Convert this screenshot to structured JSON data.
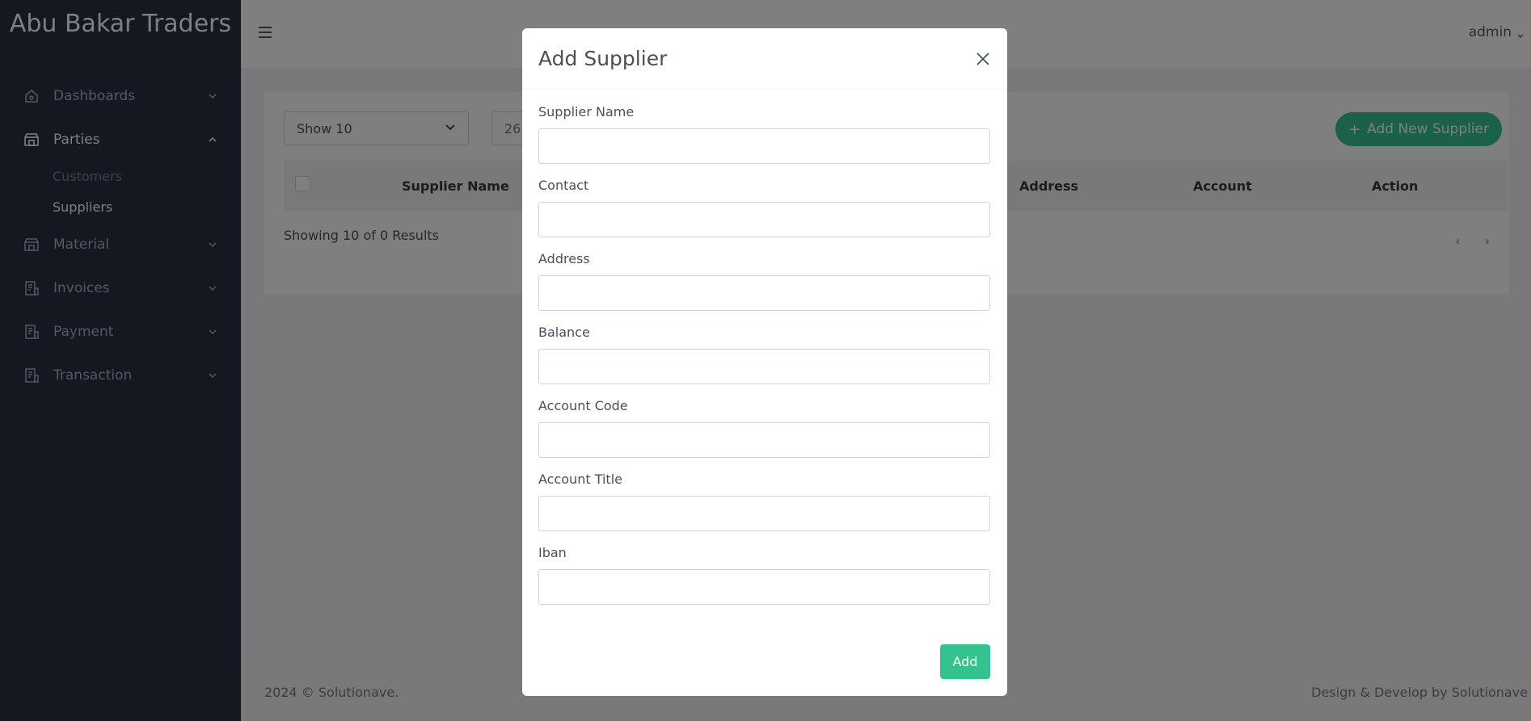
{
  "sidebar": {
    "brand": "Abu Bakar Traders",
    "items": [
      {
        "label": "Dashboards",
        "icon": "home-icon"
      },
      {
        "label": "Parties",
        "icon": "store-icon"
      },
      {
        "label": "Material",
        "icon": "store-icon"
      },
      {
        "label": "Invoices",
        "icon": "invoice-icon"
      },
      {
        "label": "Payment",
        "icon": "invoice-icon"
      },
      {
        "label": "Transaction",
        "icon": "invoice-icon"
      }
    ],
    "sub_items": [
      {
        "label": "Customers"
      },
      {
        "label": "Suppliers"
      }
    ]
  },
  "topbar": {
    "user": "admin"
  },
  "card": {
    "show_select": "Show 10",
    "search_value": "26",
    "add_new_label": "Add New Supplier",
    "columns": [
      "Supplier Name",
      "Address",
      "Account",
      "Action"
    ],
    "showing_text": "Showing 10 of 0 Results"
  },
  "footer": {
    "left": "2024 © Solutionave.",
    "right": "Design & Develop by Solutionave"
  },
  "modal": {
    "title": "Add Supplier",
    "fields": [
      {
        "label": "Supplier Name",
        "value": ""
      },
      {
        "label": "Contact",
        "value": ""
      },
      {
        "label": "Address",
        "value": ""
      },
      {
        "label": "Balance",
        "value": ""
      },
      {
        "label": "Account Code",
        "value": ""
      },
      {
        "label": "Account Title",
        "value": ""
      },
      {
        "label": "Iban",
        "value": ""
      }
    ],
    "submit_label": "Add"
  },
  "colors": {
    "sidebar_bg": "#2a3042",
    "accent_green": "#34c38f"
  }
}
